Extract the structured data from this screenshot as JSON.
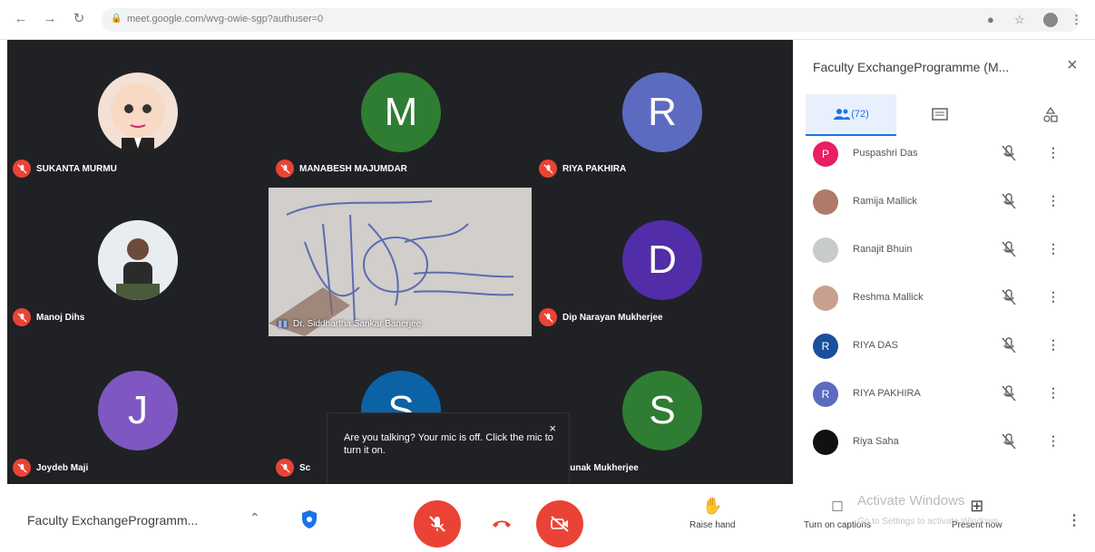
{
  "browser": {
    "url": "meet.google.com/wvg-owie-sgp?authuser=0",
    "back_icon": "arrow-left-icon",
    "forward_icon": "arrow-right-icon",
    "reload_icon": "reload-icon"
  },
  "tiles": [
    {
      "name": "SUKANTA MURMU",
      "letter": "",
      "color": "#f3e1d6"
    },
    {
      "name": "MANABESH MAJUMDAR",
      "letter": "M",
      "color": "#2e7d32"
    },
    {
      "name": "RIYA PAKHIRA",
      "letter": "R",
      "color": "#5c6bc0"
    },
    {
      "name": "Manoj Dihs",
      "letter": "",
      "color": "#dfe6ec"
    },
    {
      "name": "Dip Narayan Mukherjee",
      "letter": "D",
      "color": "#512da8"
    },
    {
      "name": "Joydeb Maji",
      "letter": "J",
      "color": "#7e57c2"
    },
    {
      "name": "Sc",
      "letter": "S",
      "color": "#0b63a5"
    },
    {
      "name": "Saunak Mukherjee",
      "letter": "S",
      "color": "#2e7d32"
    }
  ],
  "presenter": {
    "name": "Dr. Siddhartha Sankar Banerjee"
  },
  "tooltip": {
    "text": "Are you talking? Your mic is off. Click the mic to turn it on.",
    "close": "×"
  },
  "panel": {
    "title": "Faculty ExchangeProgramme (M...",
    "close": "×",
    "people_count": "(72)",
    "participants": [
      {
        "name": "Puspashri Das",
        "initial": "P",
        "color": "#e91e63"
      },
      {
        "name": "Ramija Mallick",
        "initial": "",
        "color": "#b07a6a"
      },
      {
        "name": "Ranajit Bhuin",
        "initial": "",
        "color": "#c7cbc9"
      },
      {
        "name": "Reshma Mallick",
        "initial": "",
        "color": "#c9a090"
      },
      {
        "name": "RIYA DAS",
        "initial": "R",
        "color": "#1a4f9c"
      },
      {
        "name": "RIYA PAKHIRA",
        "initial": "R",
        "color": "#5c6bc0"
      },
      {
        "name": "Riya Saha",
        "initial": "",
        "color": "#111111"
      }
    ]
  },
  "bottom": {
    "meeting_title": "Faculty ExchangeProgramm...",
    "raise_hand": "Raise hand",
    "captions": "Turn on captions",
    "present": "Present now",
    "watermark": "Activate Windows",
    "watermark_sub": "Go to Settings to activate Windows."
  },
  "colors": {
    "accent": "#1a73e8",
    "danger": "#ea4335",
    "stage": "#202124"
  }
}
